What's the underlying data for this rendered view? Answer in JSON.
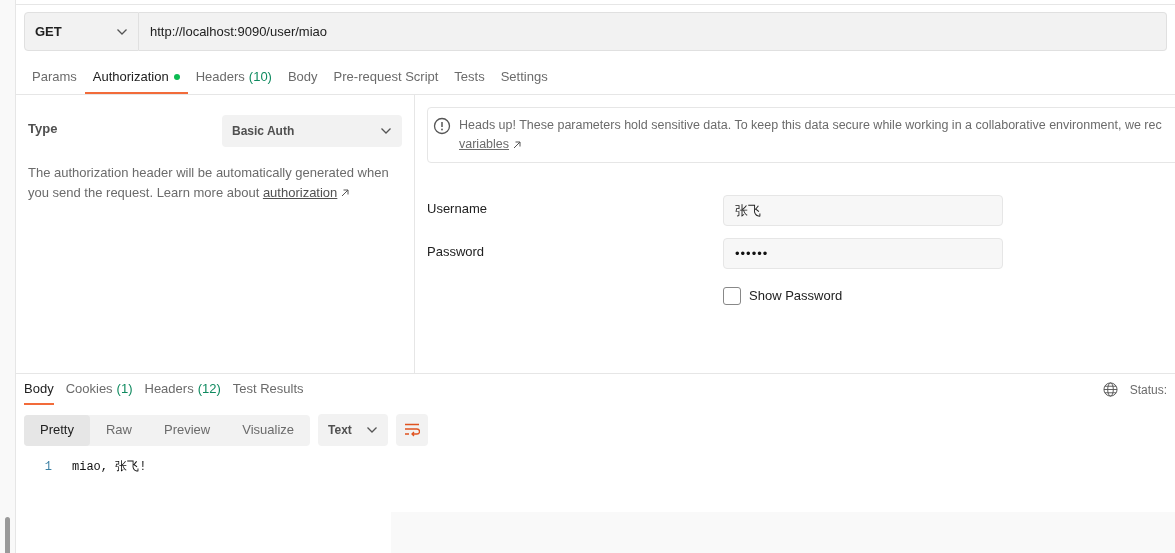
{
  "request": {
    "method": "GET",
    "url": "http://localhost:9090/user/miao"
  },
  "request_tabs": [
    {
      "label": "Params",
      "selected": false
    },
    {
      "label": "Authorization",
      "selected": true,
      "dot": true
    },
    {
      "label": "Headers",
      "count": "(10)",
      "selected": false
    },
    {
      "label": "Body",
      "selected": false
    },
    {
      "label": "Pre-request Script",
      "selected": false
    },
    {
      "label": "Tests",
      "selected": false
    },
    {
      "label": "Settings",
      "selected": false
    }
  ],
  "auth": {
    "type_label": "Type",
    "type_value": "Basic Auth",
    "description": "The authorization header will be automatically generated when you send the request. Learn more about",
    "description_link": "authorization"
  },
  "notice": {
    "text": "Heads up! These parameters hold sensitive data. To keep this data secure while working in a collaborative environment, we rec",
    "link": "variables"
  },
  "fields": [
    {
      "label": "Username",
      "value": "张飞",
      "kind": "text"
    },
    {
      "label": "Password",
      "value": "••••••",
      "kind": "password"
    }
  ],
  "show_password": {
    "label": "Show Password",
    "checked": false
  },
  "response_tabs": [
    {
      "label": "Body",
      "selected": true
    },
    {
      "label": "Cookies",
      "count": "(1)",
      "selected": false
    },
    {
      "label": "Headers",
      "count": "(12)",
      "selected": false
    },
    {
      "label": "Test Results",
      "selected": false
    }
  ],
  "status_label": "Status:",
  "view_modes": [
    {
      "label": "Pretty",
      "selected": true
    },
    {
      "label": "Raw",
      "selected": false
    },
    {
      "label": "Preview",
      "selected": false
    },
    {
      "label": "Visualize",
      "selected": false
    }
  ],
  "format": "Text",
  "response_lines": [
    {
      "number": "1",
      "text": "miao, 张飞!"
    }
  ]
}
